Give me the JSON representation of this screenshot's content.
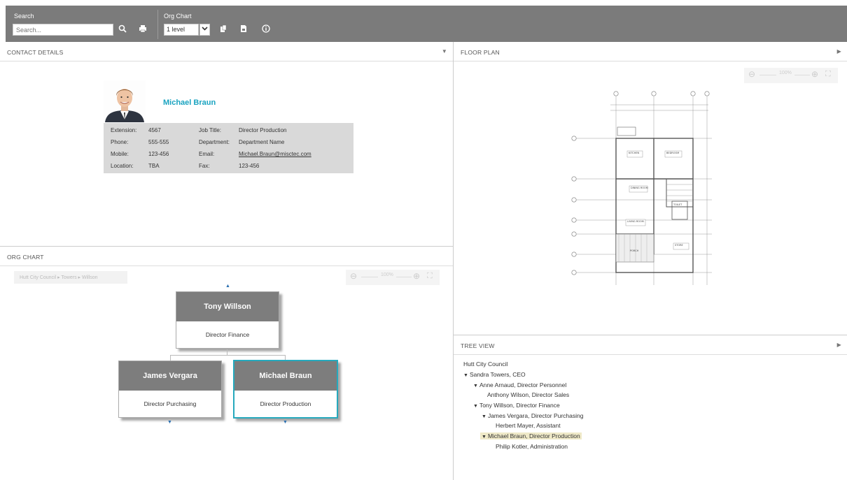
{
  "toolbar": {
    "search_title": "Search",
    "search_placeholder": "Search...",
    "org_title": "Org Chart",
    "level_value": "1 level",
    "icons": [
      "search-icon",
      "print-icon",
      "copy-icon",
      "export-icon",
      "info-icon"
    ]
  },
  "contact_panel": {
    "title": "CONTACT DETAILS",
    "name": "Michael Braun",
    "fields": {
      "ext_label": "Extension:",
      "ext_value": "4567",
      "phone_label": "Phone:",
      "phone_value": "555-555",
      "mobile_label": "Mobile:",
      "mobile_value": "123-456",
      "location_label": "Location:",
      "location_value": "TBA",
      "job_label": "Job Title:",
      "job_value": "Director Production",
      "dept_label": "Department:",
      "dept_value": "Department Name",
      "email_label": "Email:",
      "email_value": "Michael.Braun@misctec.com",
      "fax_label": "Fax:",
      "fax_value": "123-456"
    }
  },
  "org_panel": {
    "title": "ORG CHART",
    "breadcrumb": "Hutt City Council  ▸  Towers  ▸  Willson",
    "zoom_label": "100%",
    "nodes": [
      {
        "name": "Tony Willson",
        "role": "Director Finance"
      },
      {
        "name": "James Vergara",
        "role": "Director Purchasing"
      },
      {
        "name": "Michael Braun",
        "role": "Director Production"
      }
    ]
  },
  "floor_panel": {
    "title": "FLOOR PLAN",
    "zoom_label": "100%",
    "rooms": [
      "KITCHEN",
      "BEDROOM",
      "DINING ROOM",
      "LIVING ROOM",
      "TOILET",
      "PORCH",
      "STORE"
    ]
  },
  "tree_panel": {
    "title": "TREE VIEW",
    "items": [
      "Hutt City Council",
      "Sandra Towers, CEO",
      "Anne Arnaud, Director Personnel",
      "Anthony Wilson, Director Sales",
      "Tony Willson, Director Finance",
      "James Vergara, Director Purchasing",
      "Herbert Mayer, Assistant",
      "Michael Braun, Director Production",
      "Philip Kotler, Administration"
    ]
  },
  "colors": {
    "toolbar": "#7b7b7b",
    "accent": "#1aa3c0",
    "node_head": "#7d7d7d",
    "highlight": "#efe9c8"
  }
}
